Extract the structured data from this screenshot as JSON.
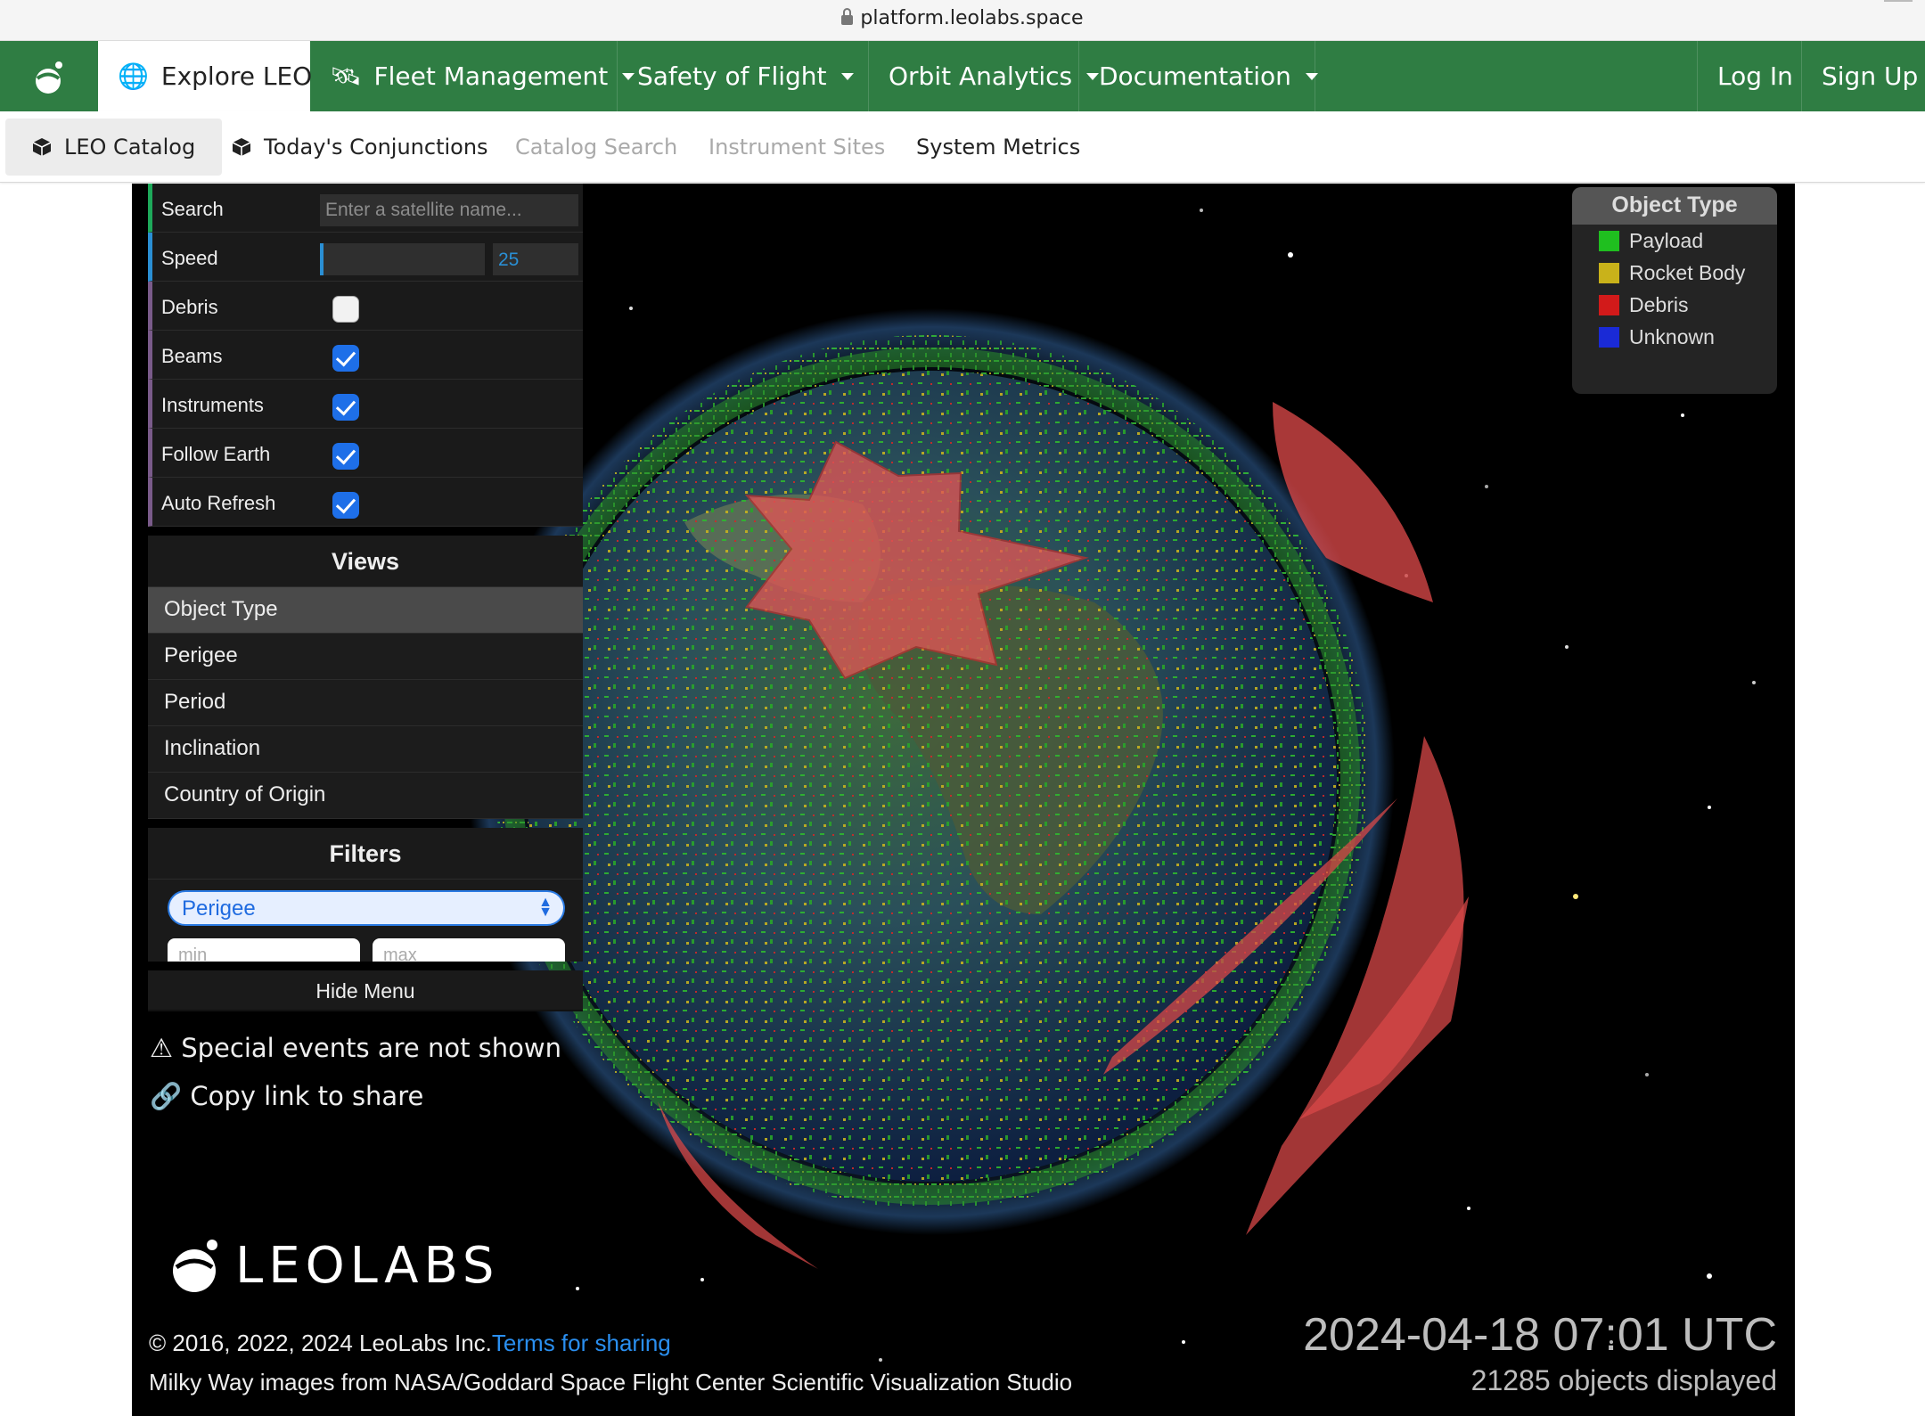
{
  "browser": {
    "url": "platform.leolabs.space"
  },
  "topnav": {
    "items": [
      {
        "label": "Explore LEO",
        "icon": "globe-icon",
        "active": true
      },
      {
        "label": "Fleet Management",
        "icon": "satellite-icon",
        "dropdown": true
      },
      {
        "label": "Safety of Flight",
        "dropdown": true
      },
      {
        "label": "Orbit Analytics",
        "dropdown": true
      },
      {
        "label": "Documentation",
        "dropdown": true
      }
    ],
    "login": "Log In",
    "signup": "Sign Up"
  },
  "subnav": {
    "items": [
      {
        "label": "LEO Catalog",
        "active": true,
        "icon": "cube-icon"
      },
      {
        "label": "Today's Conjunctions",
        "icon": "cube-icon"
      },
      {
        "label": "Catalog Search",
        "disabled": true
      },
      {
        "label": "Instrument Sites",
        "disabled": true
      },
      {
        "label": "System Metrics"
      }
    ]
  },
  "controls": {
    "search_label": "Search",
    "search_placeholder": "Enter a satellite name...",
    "speed_label": "Speed",
    "speed_value": "25",
    "toggles": [
      {
        "label": "Debris",
        "checked": false
      },
      {
        "label": "Beams",
        "checked": true
      },
      {
        "label": "Instruments",
        "checked": true
      },
      {
        "label": "Follow Earth",
        "checked": true
      },
      {
        "label": "Auto Refresh",
        "checked": true
      }
    ]
  },
  "views": {
    "title": "Views",
    "items": [
      "Object Type",
      "Perigee",
      "Period",
      "Inclination",
      "Country of Origin"
    ],
    "selected": "Object Type"
  },
  "filters": {
    "title": "Filters",
    "selected": "Perigee",
    "min_placeholder": "min",
    "max_placeholder": "max"
  },
  "hide_menu": "Hide Menu",
  "notes": {
    "special_events": "Special events are not shown",
    "copy_link": "Copy link to share"
  },
  "legend": {
    "title": "Object Type",
    "items": [
      {
        "label": "Payload",
        "color": "#1fbf1f"
      },
      {
        "label": "Rocket Body",
        "color": "#c9b21a"
      },
      {
        "label": "Debris",
        "color": "#d21a1a"
      },
      {
        "label": "Unknown",
        "color": "#1a2ad6"
      }
    ]
  },
  "brand": {
    "wordmark": "LEOLABS"
  },
  "footer": {
    "copyright": "© 2016, 2022, 2024 LeoLabs Inc.",
    "terms_link": "Terms for sharing",
    "credit": "Milky Way images from NASA/Goddard Space Flight Center Scientific Visualization Studio"
  },
  "status": {
    "datetime": "2024-04-18 07:01 UTC",
    "objects": "21285 objects displayed"
  },
  "colors": {
    "nav_green": "#2f7d43",
    "accent_blue": "#1e6fe8",
    "beam_red": "#e05050"
  }
}
